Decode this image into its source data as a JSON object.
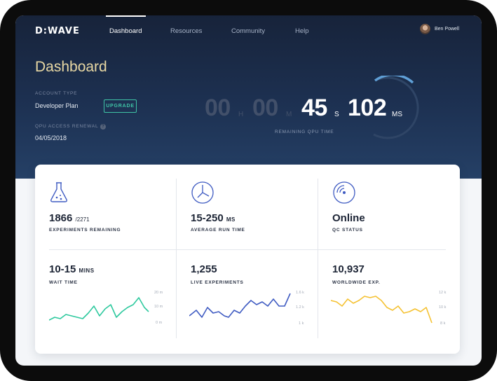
{
  "nav": {
    "logo": "D:WAVE",
    "links": [
      "Dashboard",
      "Resources",
      "Community",
      "Help"
    ],
    "active": "Dashboard",
    "user_name": "Ben Powell"
  },
  "header": {
    "title": "Dashboard",
    "account_type_label": "ACCOUNT TYPE",
    "account_type_value": "Developer Plan",
    "upgrade_label": "UPGRADE",
    "renewal_label": "QPU ACCESS RENEWAL",
    "renewal_info_icon": "?",
    "renewal_value": "04/05/2018"
  },
  "timer": {
    "hours": "00",
    "hours_unit": "H",
    "minutes": "00",
    "minutes_unit": "M",
    "seconds": "45",
    "seconds_unit": "S",
    "ms": "102",
    "ms_unit": "MS",
    "caption": "REMAINING QPU TIME"
  },
  "stats": {
    "experiments": {
      "value": "1866",
      "total": "/2271",
      "label": "EXPERIMENTS REMAINING",
      "icon": "flask-icon"
    },
    "run_time": {
      "value": "15-250",
      "unit": "MS",
      "label": "AVERAGE RUN TIME",
      "icon": "clock-icon"
    },
    "qc": {
      "value": "Online",
      "label": "QC STATUS",
      "icon": "signal-icon"
    },
    "wait": {
      "value": "10-15",
      "unit": "MINS",
      "label": "WAIT TIME"
    },
    "live": {
      "value": "1,255",
      "label": "LIVE EXPERIMENTS"
    },
    "worldwide": {
      "value": "10,937",
      "label": "WORLDWIDE EXP."
    }
  },
  "charts": {
    "wait": {
      "color": "#2ec99e",
      "axis": [
        "20 m",
        "10 m",
        "0 m"
      ]
    },
    "live": {
      "color": "#3f5bc2",
      "axis": [
        "1.6 k",
        "1.2 k",
        "1 k"
      ]
    },
    "worldwide": {
      "color": "#f5c232",
      "axis": [
        "12 k",
        "10 k",
        "8 k"
      ]
    }
  }
}
